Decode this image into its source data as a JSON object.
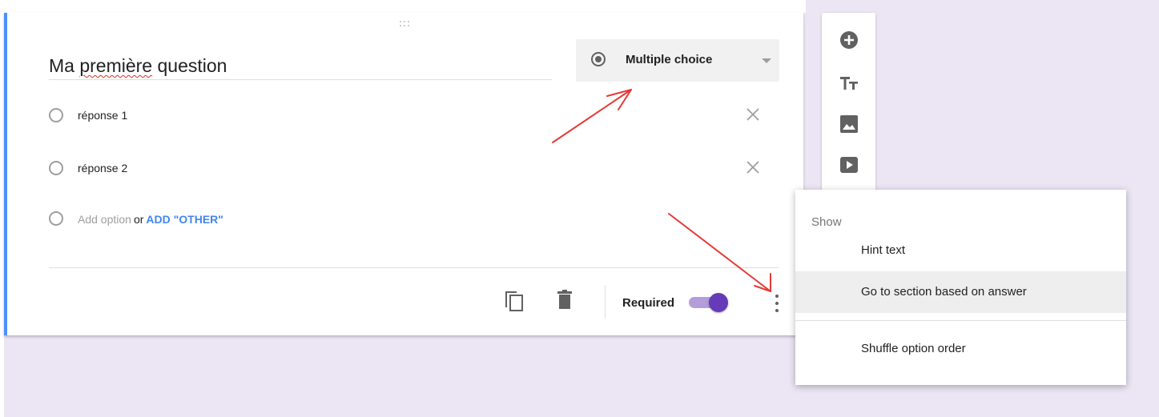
{
  "question": {
    "title_pre": "Ma ",
    "title_misspelled": "première",
    "title_post": " question",
    "type_label": "Multiple choice",
    "options": [
      {
        "label": "réponse 1"
      },
      {
        "label": "réponse 2"
      }
    ],
    "add_option_label": "Add option",
    "or_label": "or",
    "add_other_label": "ADD \"OTHER\"",
    "required_label": "Required",
    "required_on": true
  },
  "side_toolbar": {
    "items": [
      {
        "icon": "add-circle-icon"
      },
      {
        "icon": "title-text-icon"
      },
      {
        "icon": "image-icon"
      },
      {
        "icon": "video-icon"
      }
    ]
  },
  "menu": {
    "header": "Show",
    "items": [
      {
        "label": "Hint text"
      },
      {
        "label": "Go to section based on answer"
      },
      {
        "label": "Shuffle option order"
      }
    ]
  },
  "colors": {
    "accent_blue": "#4d90fe",
    "toggle_purple": "#673ab7",
    "toggle_track": "#b39ddb",
    "link_blue": "#4285f4",
    "background": "#ebe5f4",
    "annotation_red": "#e53935"
  }
}
